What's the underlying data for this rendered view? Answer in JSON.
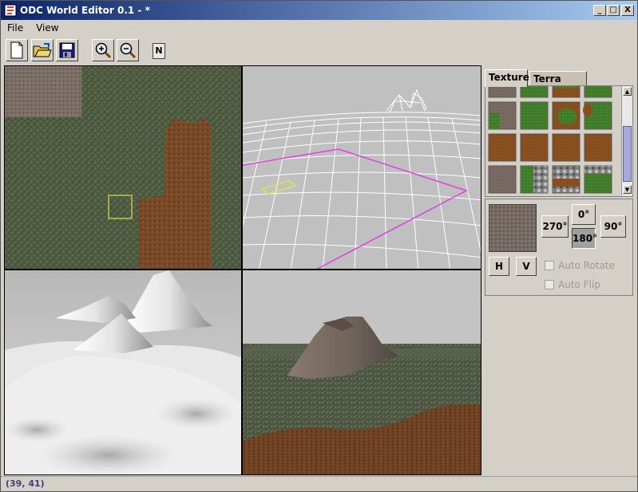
{
  "window": {
    "title": "ODC World Editor 0.1 - *",
    "minimize": "_",
    "maximize": "□",
    "close": "X"
  },
  "menu": {
    "file": "File",
    "view": "View"
  },
  "toolbar": {
    "n_label": "N"
  },
  "sidebar": {
    "tabs": [
      "Texture",
      "Terra Form"
    ],
    "active_tab": "Texture",
    "rotation": {
      "r270": "270°",
      "r0": "0°",
      "r90": "90°",
      "r180": "180°",
      "selected": "180°"
    },
    "flip_h": "H",
    "flip_v": "V",
    "auto_rotate": "Auto Rotate",
    "auto_flip": "Auto Flip"
  },
  "status": {
    "coords": "(39, 41)"
  },
  "colors": {
    "grass": "#4a5a3a",
    "dirt": "#7a4a28",
    "rock": "#807068",
    "wire_sky": "#c0c0c0",
    "selection": "#e0e050",
    "boundary": "#e040e0"
  }
}
